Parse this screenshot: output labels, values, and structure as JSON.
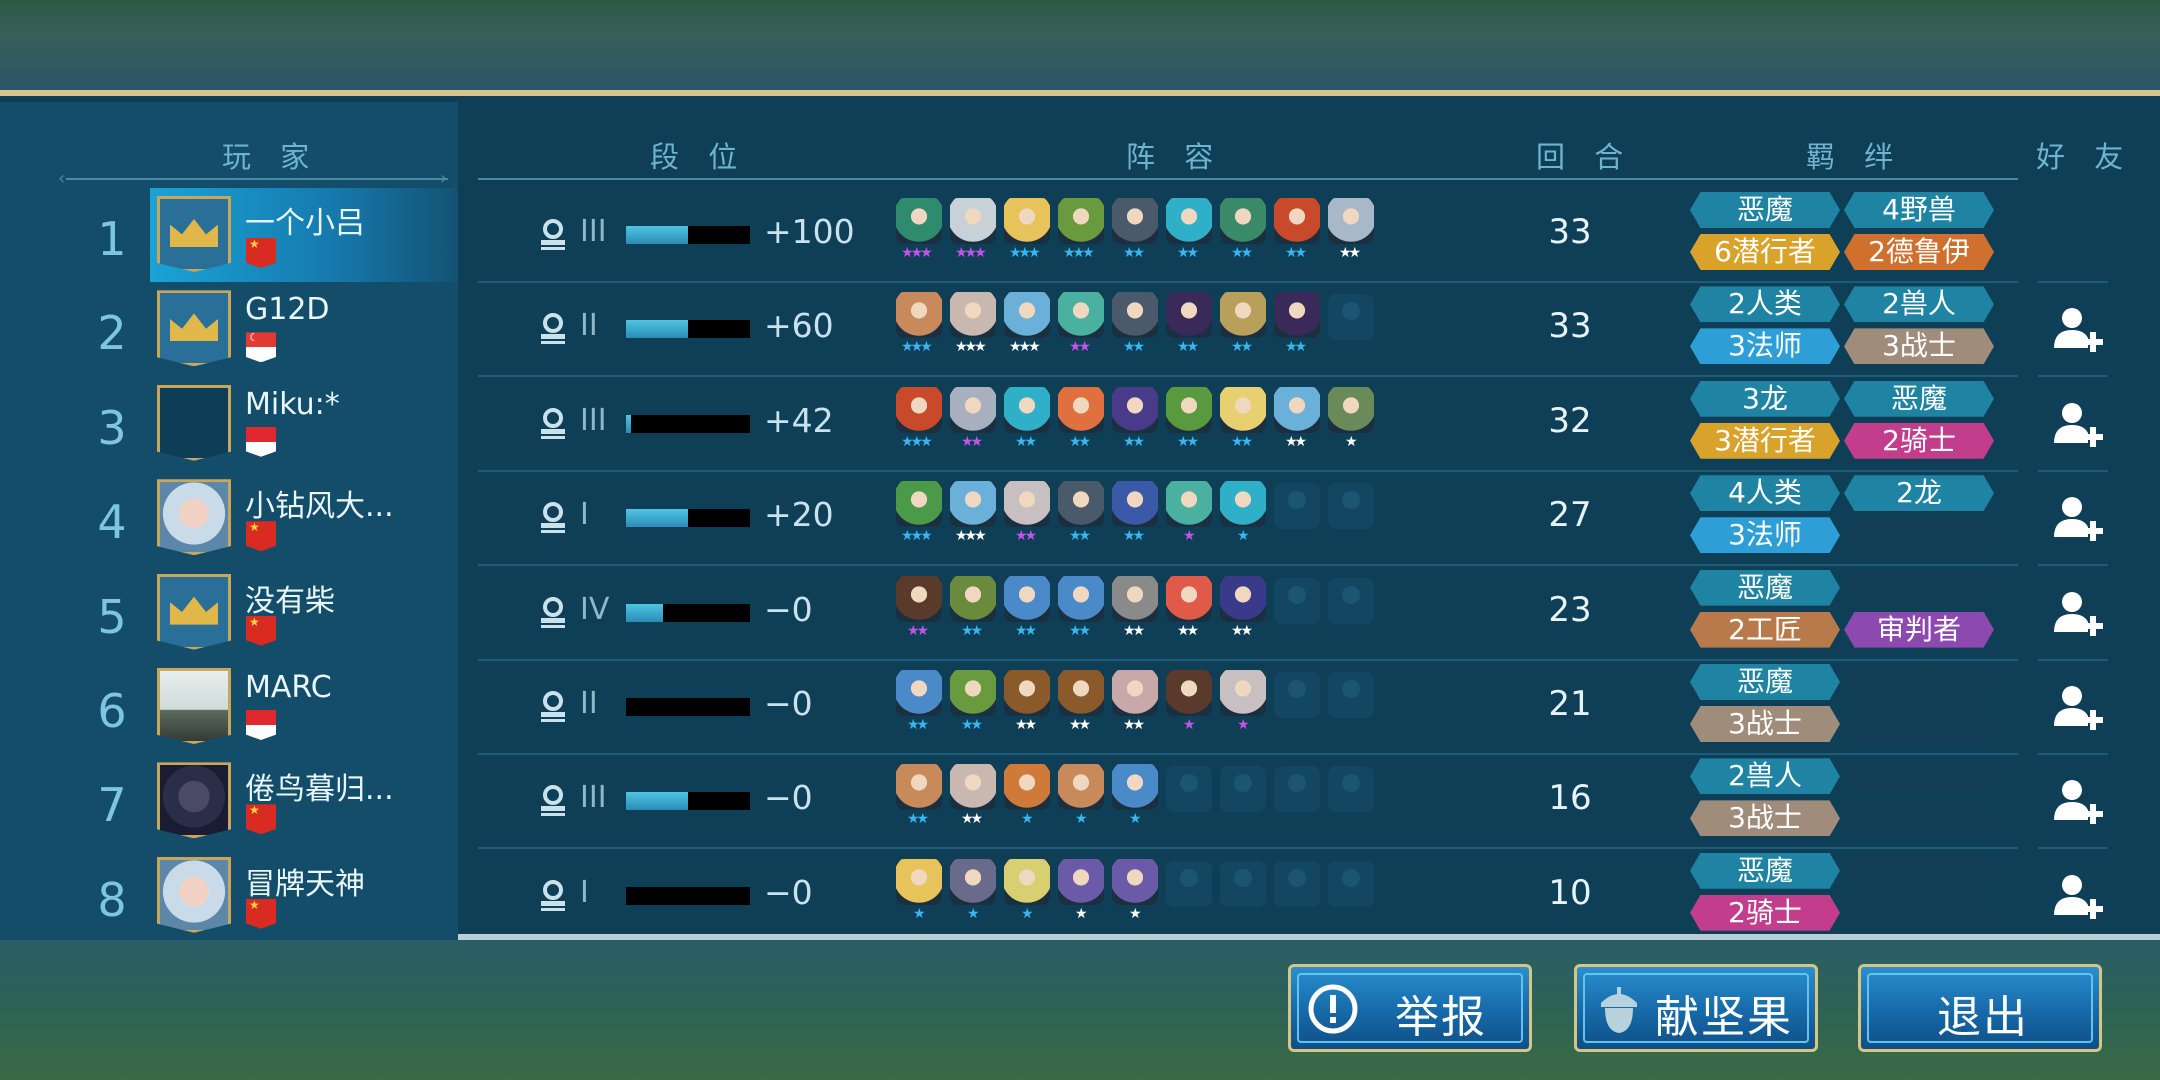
{
  "colors": {
    "trait_teal": "#1f84a3",
    "trait_orange": "#d67a2d",
    "trait_blue": "#2d9ed6",
    "trait_tan": "#a08c7b",
    "trait_pink": "#c23d8c",
    "trait_gold": "#d9a22a",
    "trait_brown": "#b87a4b",
    "trait_purple": "#8c4ab0",
    "trait_orange2": "#d0702e",
    "star_purple": "#c453e6",
    "star_blue": "#38b6f0",
    "star_white": "#ffffff",
    "star_cyan": "#5bc3e3"
  },
  "headers": {
    "player": "玩 家",
    "rank": "段 位",
    "lineup": "阵 容",
    "round": "回 合",
    "traits": "羁 绊",
    "friends": "好 友"
  },
  "players": [
    {
      "rank": "1",
      "name": "一个小吕",
      "avatar": "crown",
      "flag": "cn",
      "tier": "III",
      "tier_fill": 0.5,
      "score": "+100",
      "round": "33",
      "highlight": true,
      "friend_button": false,
      "heroes": [
        {
          "color": "#2e8b6e",
          "star": "purple",
          "n": 3
        },
        {
          "color": "#c8d0d8",
          "star": "purple",
          "n": 3
        },
        {
          "color": "#e8c25a",
          "star": "blue",
          "n": 3
        },
        {
          "color": "#6a9a3e",
          "star": "blue",
          "n": 3
        },
        {
          "color": "#4a5a6a",
          "star": "blue",
          "n": 2
        },
        {
          "color": "#2fb0c8",
          "star": "blue",
          "n": 2
        },
        {
          "color": "#3a8a6a",
          "star": "blue",
          "n": 2
        },
        {
          "color": "#c84a2a",
          "star": "blue",
          "n": 2
        },
        {
          "color": "#a8b8c8",
          "star": "white",
          "n": 2
        }
      ],
      "traits": [
        {
          "label": "恶魔",
          "color": "#1f84a3"
        },
        {
          "label": "4野兽",
          "color": "#1f84a3"
        },
        {
          "label": "6潜行者",
          "color": "#d9a22a"
        },
        {
          "label": "2德鲁伊",
          "color": "#d0702e"
        }
      ]
    },
    {
      "rank": "2",
      "name": "G12D",
      "avatar": "crown",
      "flag": "sg",
      "tier": "II",
      "tier_fill": 0.5,
      "score": "+60",
      "round": "33",
      "highlight": false,
      "friend_button": true,
      "heroes": [
        {
          "color": "#c88a5a",
          "star": "blue",
          "n": 3
        },
        {
          "color": "#c8b8b0",
          "star": "white",
          "n": 3
        },
        {
          "color": "#6ab0d8",
          "star": "white",
          "n": 3
        },
        {
          "color": "#4ab0a0",
          "star": "purple",
          "n": 2
        },
        {
          "color": "#4a5a6a",
          "star": "blue",
          "n": 2
        },
        {
          "color": "#3a2a5a",
          "star": "blue",
          "n": 2
        },
        {
          "color": "#b8a05a",
          "star": "blue",
          "n": 2
        },
        {
          "color": "#3a2a5a",
          "star": "blue",
          "n": 2
        }
      ],
      "traits": [
        {
          "label": "2人类",
          "color": "#1f84a3"
        },
        {
          "label": "2兽人",
          "color": "#1f84a3"
        },
        {
          "label": "3法师",
          "color": "#2d9ed6"
        },
        {
          "label": "3战士",
          "color": "#a08c7b"
        }
      ]
    },
    {
      "rank": "3",
      "name": "Miku:*",
      "avatar": "empty",
      "flag": "id",
      "tier": "III",
      "tier_fill": 0.04,
      "score": "+42",
      "round": "32",
      "highlight": false,
      "friend_button": true,
      "heroes": [
        {
          "color": "#c84a2a",
          "star": "blue",
          "n": 3
        },
        {
          "color": "#a8b0c0",
          "star": "purple",
          "n": 2
        },
        {
          "color": "#2fb0c8",
          "star": "blue",
          "n": 2
        },
        {
          "color": "#e07040",
          "star": "blue",
          "n": 2
        },
        {
          "color": "#4a3a8a",
          "star": "blue",
          "n": 2
        },
        {
          "color": "#5a9a3e",
          "star": "blue",
          "n": 2
        },
        {
          "color": "#e8d070",
          "star": "blue",
          "n": 2
        },
        {
          "color": "#6ab0d8",
          "star": "white",
          "n": 2
        },
        {
          "color": "#6a8a5a",
          "star": "white",
          "n": 1
        }
      ],
      "traits": [
        {
          "label": "3龙",
          "color": "#1f84a3"
        },
        {
          "label": "恶魔",
          "color": "#1f84a3"
        },
        {
          "label": "3潜行者",
          "color": "#d9a22a"
        },
        {
          "label": "2骑士",
          "color": "#c23d8c"
        }
      ]
    },
    {
      "rank": "4",
      "name": "小钻风大...",
      "avatar": "girl",
      "flag": "cn",
      "tier": "I",
      "tier_fill": 0.5,
      "score": "+20",
      "round": "27",
      "highlight": false,
      "friend_button": true,
      "heroes": [
        {
          "color": "#4a9a4a",
          "star": "blue",
          "n": 3
        },
        {
          "color": "#6ab0d8",
          "star": "white",
          "n": 3
        },
        {
          "color": "#c8c0c0",
          "star": "purple",
          "n": 2
        },
        {
          "color": "#4a5a6a",
          "star": "blue",
          "n": 2
        },
        {
          "color": "#3a5aa8",
          "star": "blue",
          "n": 2
        },
        {
          "color": "#4ab0a0",
          "star": "purple",
          "n": 1
        },
        {
          "color": "#2fb0c8",
          "star": "blue",
          "n": 1
        }
      ],
      "traits": [
        {
          "label": "4人类",
          "color": "#1f84a3"
        },
        {
          "label": "2龙",
          "color": "#1f84a3"
        },
        {
          "label": "3法师",
          "color": "#2d9ed6"
        },
        {
          "label": "",
          "color": ""
        }
      ]
    },
    {
      "rank": "5",
      "name": "没有柴",
      "avatar": "crown",
      "flag": "cn",
      "tier": "IV",
      "tier_fill": 0.3,
      "score": "−0",
      "round": "23",
      "highlight": false,
      "friend_button": true,
      "heroes": [
        {
          "color": "#5a3a2a",
          "star": "purple",
          "n": 2
        },
        {
          "color": "#6a8a3e",
          "star": "blue",
          "n": 2
        },
        {
          "color": "#4a8ac8",
          "star": "blue",
          "n": 2
        },
        {
          "color": "#4a8ac8",
          "star": "blue",
          "n": 2
        },
        {
          "color": "#8a8a8a",
          "star": "white",
          "n": 2
        },
        {
          "color": "#e05a4a",
          "star": "white",
          "n": 2
        },
        {
          "color": "#3a3a8a",
          "star": "white",
          "n": 2
        }
      ],
      "traits": [
        {
          "label": "恶魔",
          "color": "#1f84a3"
        },
        {
          "label": "",
          "color": ""
        },
        {
          "label": "2工匠",
          "color": "#b87a4b"
        },
        {
          "label": "审判者",
          "color": "#8c4ab0"
        }
      ]
    },
    {
      "rank": "6",
      "name": "MARC",
      "avatar": "photo",
      "flag": "id",
      "tier": "II",
      "tier_fill": 0.0,
      "score": "−0",
      "round": "21",
      "highlight": false,
      "friend_button": true,
      "heroes": [
        {
          "color": "#4a8ac8",
          "star": "blue",
          "n": 2
        },
        {
          "color": "#6a9a3e",
          "star": "blue",
          "n": 2
        },
        {
          "color": "#8a5a2a",
          "star": "white",
          "n": 2
        },
        {
          "color": "#8a5a2a",
          "star": "white",
          "n": 2
        },
        {
          "color": "#c8a8a8",
          "star": "white",
          "n": 2
        },
        {
          "color": "#5a3a2a",
          "star": "purple",
          "n": 1
        },
        {
          "color": "#c8c0c0",
          "star": "purple",
          "n": 1
        }
      ],
      "traits": [
        {
          "label": "恶魔",
          "color": "#1f84a3"
        },
        {
          "label": "",
          "color": ""
        },
        {
          "label": "3战士",
          "color": "#a08c7b"
        },
        {
          "label": "",
          "color": ""
        }
      ]
    },
    {
      "rank": "7",
      "name": "倦鸟暮归...",
      "avatar": "knight",
      "flag": "cn",
      "tier": "III",
      "tier_fill": 0.5,
      "score": "−0",
      "round": "16",
      "highlight": false,
      "friend_button": true,
      "heroes": [
        {
          "color": "#c88a5a",
          "star": "blue",
          "n": 2
        },
        {
          "color": "#c8b8b0",
          "star": "white",
          "n": 2
        },
        {
          "color": "#d07a3a",
          "star": "blue",
          "n": 1
        },
        {
          "color": "#c88a5a",
          "star": "blue",
          "n": 1
        },
        {
          "color": "#4a8ac8",
          "star": "blue",
          "n": 1
        }
      ],
      "traits": [
        {
          "label": "2兽人",
          "color": "#1f84a3"
        },
        {
          "label": "",
          "color": ""
        },
        {
          "label": "3战士",
          "color": "#a08c7b"
        },
        {
          "label": "",
          "color": ""
        }
      ]
    },
    {
      "rank": "8",
      "name": "冒牌天神",
      "avatar": "girl",
      "flag": "cn",
      "tier": "I",
      "tier_fill": 0.0,
      "score": "−0",
      "round": "10",
      "highlight": false,
      "friend_button": true,
      "heroes": [
        {
          "color": "#e8c25a",
          "star": "blue",
          "n": 1
        },
        {
          "color": "#6a6a8a",
          "star": "blue",
          "n": 1
        },
        {
          "color": "#d8d070",
          "star": "blue",
          "n": 1
        },
        {
          "color": "#6a5aa8",
          "star": "white",
          "n": 1
        },
        {
          "color": "#6a5aa8",
          "star": "white",
          "n": 1
        }
      ],
      "traits": [
        {
          "label": "恶魔",
          "color": "#1f84a3"
        },
        {
          "label": "",
          "color": ""
        },
        {
          "label": "2骑士",
          "color": "#c23d8c"
        },
        {
          "label": "",
          "color": ""
        }
      ]
    }
  ],
  "buttons": {
    "report": "举报",
    "nuts": "献坚果",
    "exit": "退出"
  }
}
